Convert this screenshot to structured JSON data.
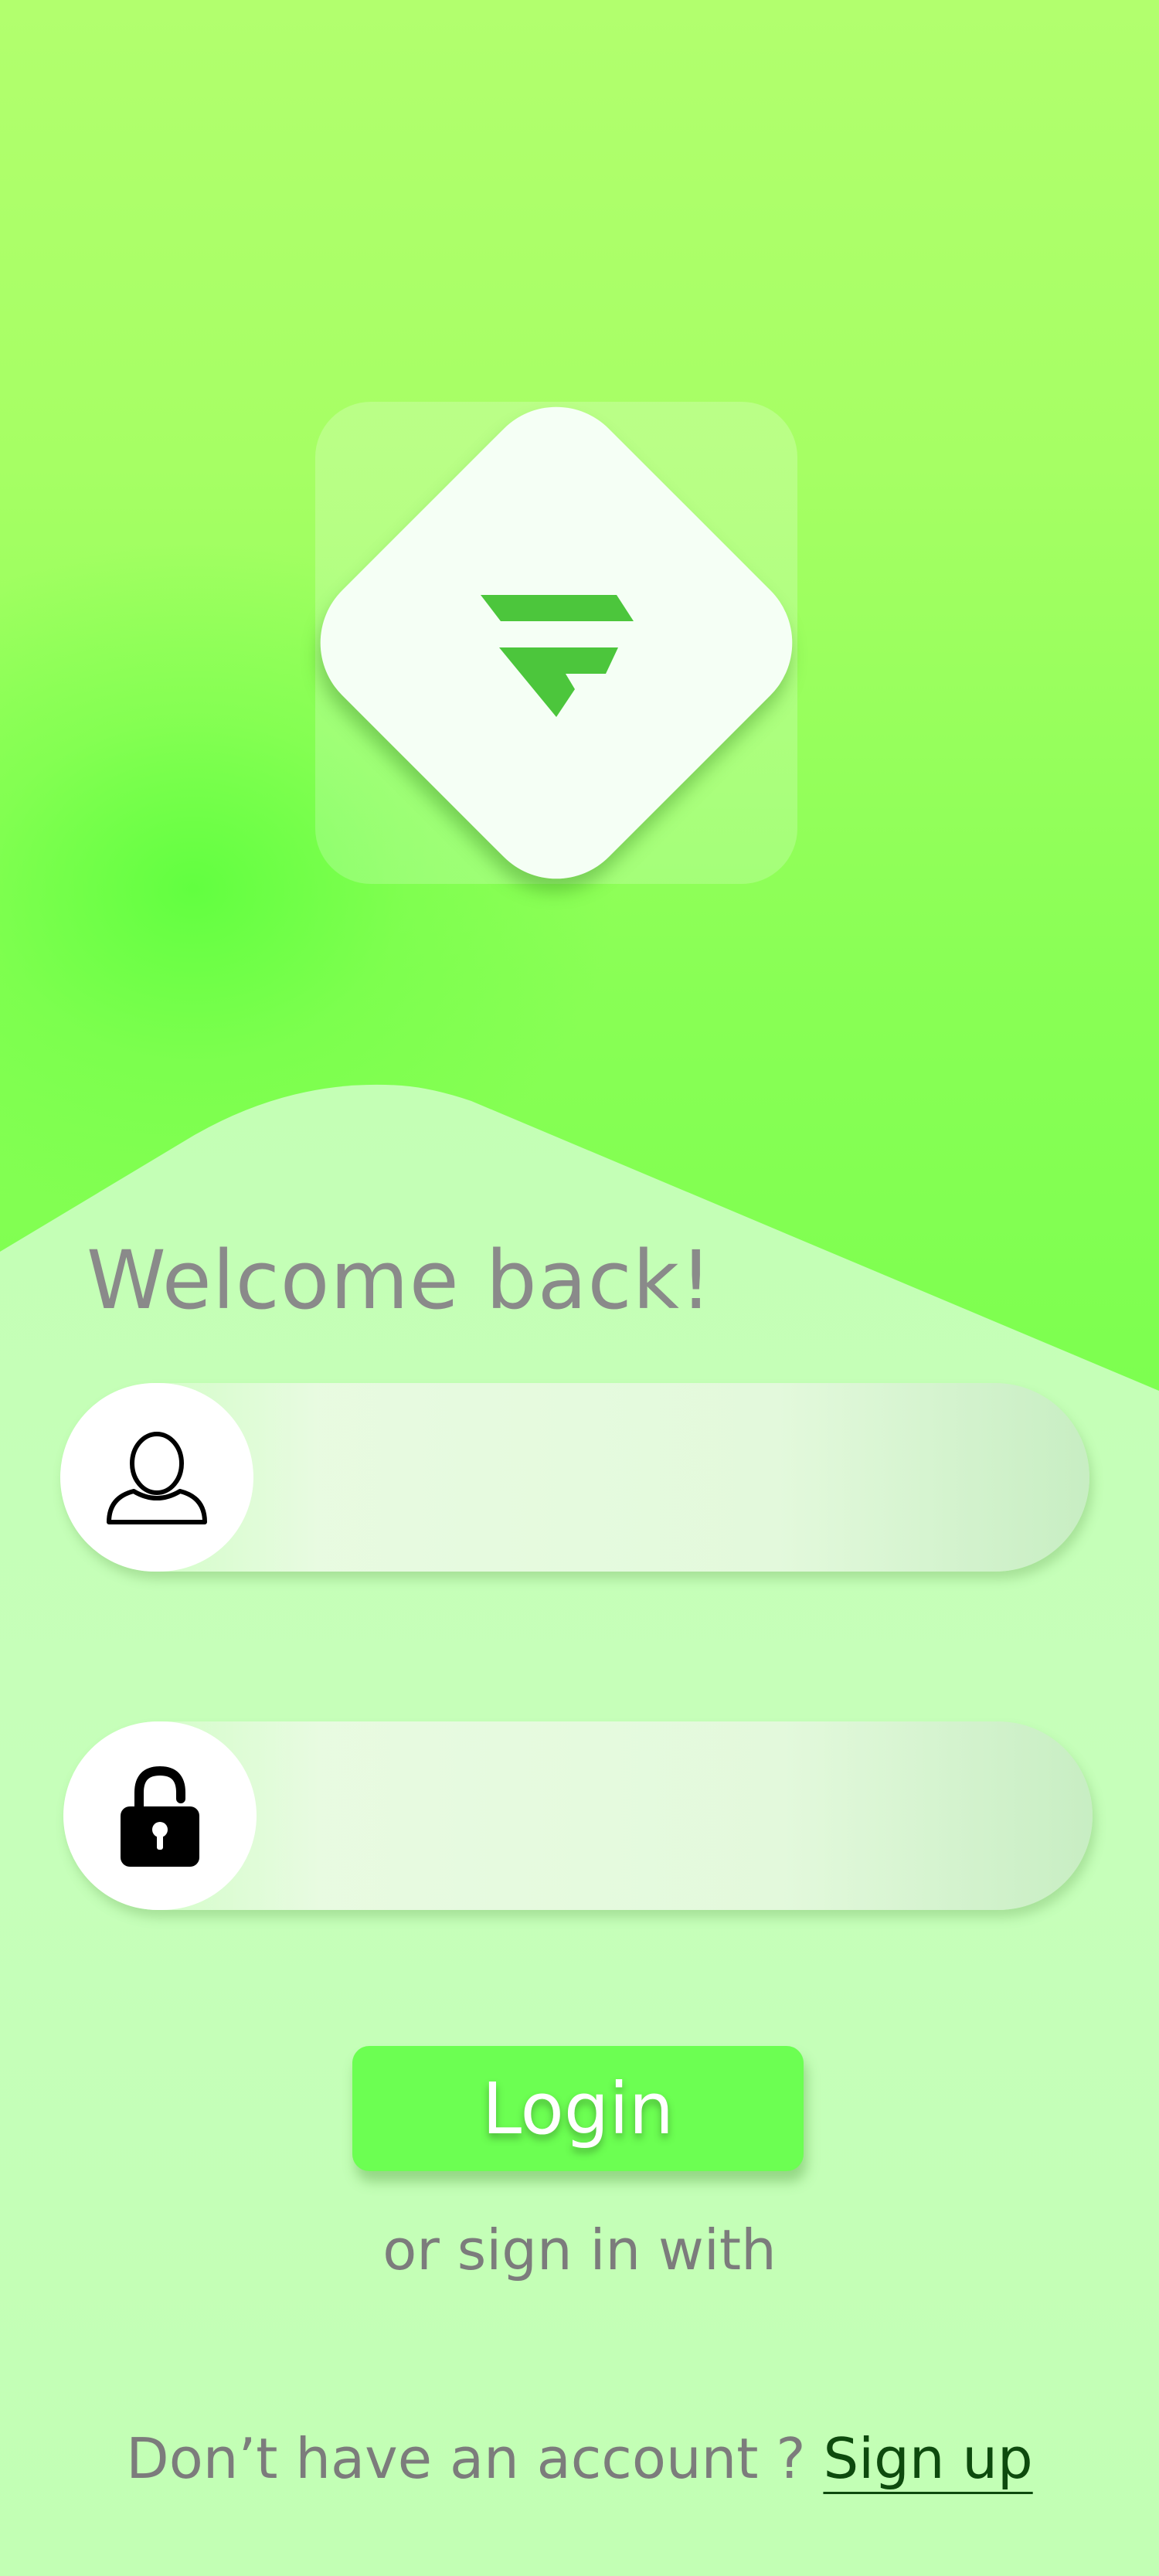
{
  "header": {
    "logo_icon": "brand-diamond-logo-icon"
  },
  "login_form": {
    "title": "Welcome back!",
    "username": {
      "icon": "user-icon",
      "value": "",
      "placeholder": ""
    },
    "password": {
      "icon": "lock-icon",
      "value": "",
      "placeholder": ""
    },
    "login_label": "Login",
    "alt_signin_text": "or sign in with"
  },
  "footer": {
    "prompt": "Don’t have an account ?",
    "signup_label": "Sign up"
  },
  "colors": {
    "accent_green": "#6cff52",
    "logo_green": "#4cc63c",
    "text_gray": "#8a8a8a",
    "link_dark_green": "#0d4a0d"
  }
}
